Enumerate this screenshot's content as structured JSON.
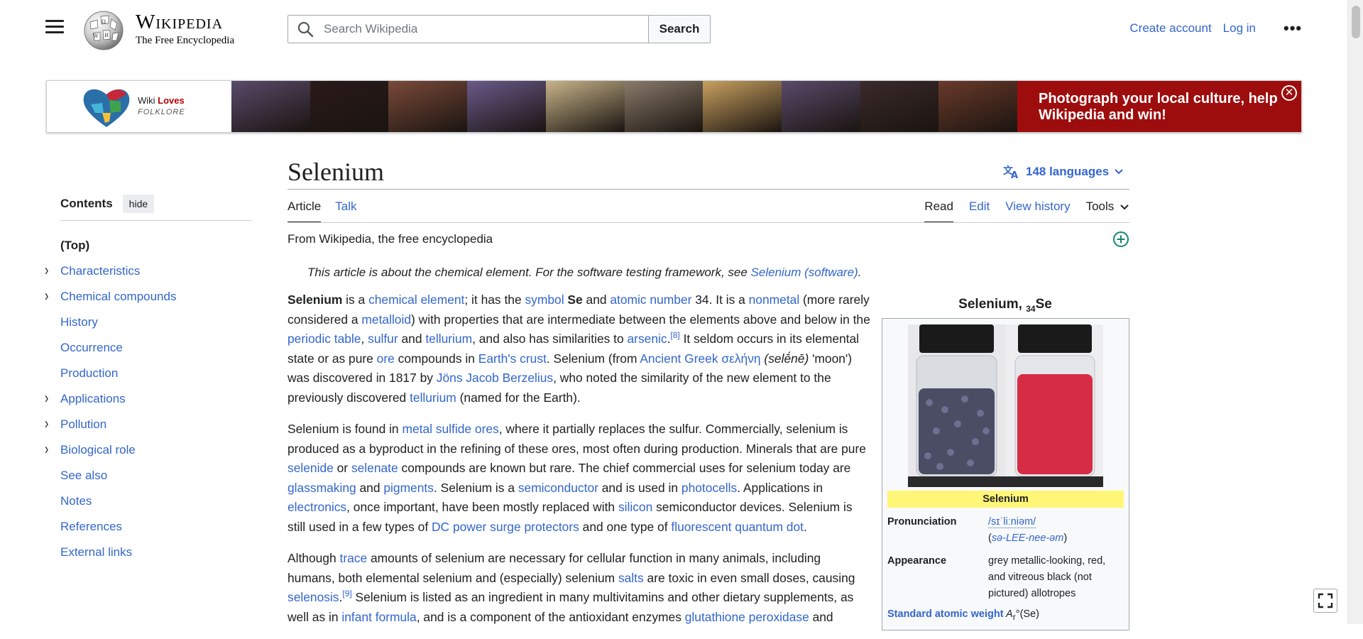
{
  "header": {
    "wordmark_title": "Wikipedia",
    "wordmark_tagline": "The Free Encyclopedia",
    "search_placeholder": "Search Wikipedia",
    "search_button": "Search",
    "create_account": "Create account",
    "log_in": "Log in",
    "more_icon": "ellipsis-icon"
  },
  "banner": {
    "logo_line1_a": "Wiki ",
    "logo_line1_b": "Loves",
    "logo_line2": "FOLKLORE",
    "cta": "Photograph your local culture, help Wikipedia and win!",
    "close_glyph": "✕",
    "photo_colors": [
      "#5a4a6a",
      "#2a1a1a",
      "#7a4a3a",
      "#6a5a8a",
      "#c8b48a",
      "#8a7a6a",
      "#c8a060",
      "#5a4a6a",
      "#3a2a2a",
      "#6a3a2a"
    ]
  },
  "toc": {
    "title": "Contents",
    "hide": "hide",
    "items": [
      {
        "label": "(Top)",
        "expandable": false
      },
      {
        "label": "Characteristics",
        "expandable": true
      },
      {
        "label": "Chemical compounds",
        "expandable": true
      },
      {
        "label": "History",
        "expandable": false
      },
      {
        "label": "Occurrence",
        "expandable": false
      },
      {
        "label": "Production",
        "expandable": false
      },
      {
        "label": "Applications",
        "expandable": true
      },
      {
        "label": "Pollution",
        "expandable": true
      },
      {
        "label": "Biological role",
        "expandable": true
      },
      {
        "label": "See also",
        "expandable": false
      },
      {
        "label": "Notes",
        "expandable": false
      },
      {
        "label": "References",
        "expandable": false
      },
      {
        "label": "External links",
        "expandable": false
      }
    ]
  },
  "article": {
    "title": "Selenium",
    "languages": "148 languages",
    "tab_article": "Article",
    "tab_talk": "Talk",
    "tab_read": "Read",
    "tab_edit": "Edit",
    "tab_history": "View history",
    "tab_tools": "Tools",
    "from": "From Wikipedia, the free encyclopedia",
    "hatnote_text": "This article is about the chemical element. For the software testing framework, see ",
    "hatnote_link": "Selenium (software)",
    "hatnote_end": ".",
    "p1": [
      {
        "t": "Selenium",
        "b": true
      },
      {
        "t": " is a "
      },
      {
        "t": "chemical element",
        "l": true
      },
      {
        "t": "; it has the "
      },
      {
        "t": "symbol",
        "l": true
      },
      {
        "t": " "
      },
      {
        "t": "Se",
        "b": true
      },
      {
        "t": " and "
      },
      {
        "t": "atomic number",
        "l": true
      },
      {
        "t": " 34. It is a "
      },
      {
        "t": "nonmetal",
        "l": true
      },
      {
        "t": " (more rarely considered a "
      },
      {
        "t": "metalloid",
        "l": true
      },
      {
        "t": ") with properties that are intermediate between the elements above and below in the "
      },
      {
        "t": "periodic table",
        "l": true
      },
      {
        "t": ", "
      },
      {
        "t": "sulfur",
        "l": true
      },
      {
        "t": " and "
      },
      {
        "t": "tellurium",
        "l": true
      },
      {
        "t": ", and also has similarities to "
      },
      {
        "t": "arsenic",
        "l": true
      },
      {
        "t": ".",
        "l": false
      },
      {
        "t": "[8]",
        "sup": true
      },
      {
        "t": " It seldom occurs in its elemental state or as pure "
      },
      {
        "t": "ore",
        "l": true
      },
      {
        "t": " compounds in "
      },
      {
        "t": "Earth's crust",
        "l": true
      },
      {
        "t": ". Selenium (from "
      },
      {
        "t": "Ancient Greek σελήνη",
        "l": true
      },
      {
        "t": " "
      },
      {
        "t": "(selḗnē)",
        "i": true
      },
      {
        "t": " 'moon') was discovered in 1817 by "
      },
      {
        "t": "Jöns Jacob Berzelius",
        "l": true
      },
      {
        "t": ", who noted the similarity of the new element to the previously discovered "
      },
      {
        "t": "tellurium",
        "l": true
      },
      {
        "t": " (named for the Earth)."
      }
    ],
    "p2": [
      {
        "t": "Selenium is found in "
      },
      {
        "t": "metal sulfide ores",
        "l": true
      },
      {
        "t": ", where it partially replaces the sulfur. Commercially, selenium is produced as a byproduct in the refining of these ores, most often during production. Minerals that are pure "
      },
      {
        "t": "selenide",
        "l": true
      },
      {
        "t": " or "
      },
      {
        "t": "selenate",
        "l": true
      },
      {
        "t": " compounds are known but rare. The chief commercial uses for selenium today are "
      },
      {
        "t": "glassmaking",
        "l": true
      },
      {
        "t": " and "
      },
      {
        "t": "pigments",
        "l": true
      },
      {
        "t": ". Selenium is a "
      },
      {
        "t": "semiconductor",
        "l": true
      },
      {
        "t": " and is used in "
      },
      {
        "t": "photocells",
        "l": true
      },
      {
        "t": ". Applications in "
      },
      {
        "t": "electronics",
        "l": true
      },
      {
        "t": ", once important, have been mostly replaced with "
      },
      {
        "t": "silicon",
        "l": true
      },
      {
        "t": " semiconductor devices. Selenium is still used in a few types of "
      },
      {
        "t": "DC power surge protectors",
        "l": true
      },
      {
        "t": " and one type of "
      },
      {
        "t": "fluorescent quantum dot",
        "l": true
      },
      {
        "t": "."
      }
    ],
    "p3": [
      {
        "t": "Although "
      },
      {
        "t": "trace",
        "l": true
      },
      {
        "t": " amounts of selenium are necessary for cellular function in many animals, including humans, both elemental selenium and (especially) selenium "
      },
      {
        "t": "salts",
        "l": true
      },
      {
        "t": " are toxic in even small doses, causing "
      },
      {
        "t": "selenosis",
        "l": true
      },
      {
        "t": "."
      },
      {
        "t": "[9]",
        "sup": true
      },
      {
        "t": " Selenium is listed as an ingredient in many multivitamins and other dietary supplements, as well as in "
      },
      {
        "t": "infant formula",
        "l": true
      },
      {
        "t": ", and is a component of the antioxidant enzymes "
      },
      {
        "t": "glutathione peroxidase",
        "l": true
      },
      {
        "t": " and"
      }
    ]
  },
  "infobox": {
    "caption_pre": "Selenium, ",
    "caption_sub": "34",
    "caption_post": "Se",
    "band": "Selenium",
    "pron_key": "Pronunciation",
    "pron_ipa": "/sɪˈliːniəm/",
    "pron_respell_open": "(",
    "pron_respell": "sə-LEE-nee-əm",
    "pron_respell_close": ")",
    "appear_key": "Appearance",
    "appear_val": "grey metallic-looking, red, and vitreous black (not pictured) allotropes",
    "saw_key": "Standard atomic weight",
    "saw_sym": " A",
    "saw_sub": "r",
    "saw_rest": "°(Se)"
  },
  "colors": {
    "link": "#3366cc",
    "banner_red": "#9e0d0d",
    "band_yellow": "#fff678",
    "add_green": "#14866d"
  }
}
